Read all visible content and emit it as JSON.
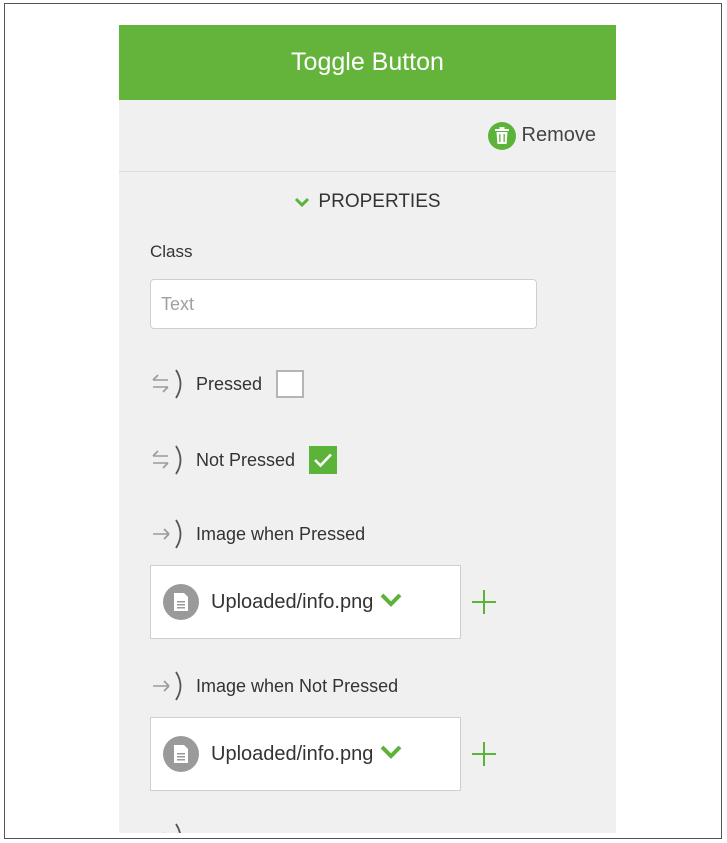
{
  "panel": {
    "title": "Toggle Button",
    "remove_label": "Remove",
    "section_label": "PROPERTIES"
  },
  "class_field": {
    "label": "Class",
    "placeholder": "Text",
    "value": ""
  },
  "pressed": {
    "label": "Pressed",
    "checked": false
  },
  "not_pressed": {
    "label": "Not Pressed",
    "checked": true
  },
  "image_pressed": {
    "label": "Image when Pressed",
    "value": "Uploaded/info.png"
  },
  "image_not_pressed": {
    "label": "Image when Not Pressed",
    "value": "Uploaded/info.png"
  },
  "icons": {
    "remove": "trash-icon",
    "section": "chevron-down-icon",
    "binding_two_way": "two-way-binding-icon",
    "binding_one_way": "one-way-binding-icon",
    "file": "document-icon",
    "dropdown": "chevron-down-icon",
    "add": "plus-icon"
  },
  "colors": {
    "accent": "#64b43c",
    "check_fill": "#5cb33a",
    "panel_bg": "#f0f0f0"
  }
}
